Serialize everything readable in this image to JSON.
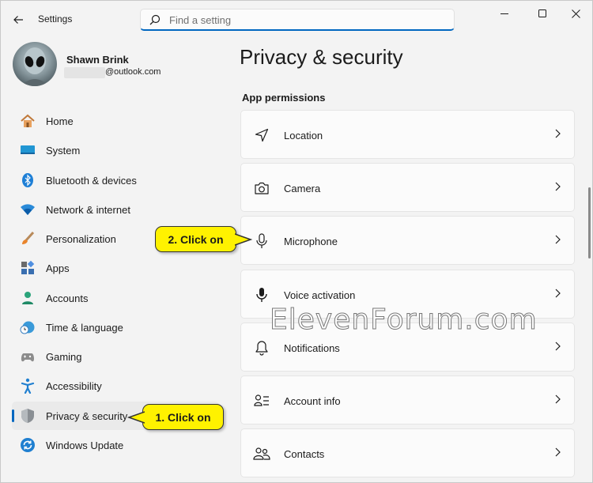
{
  "window": {
    "title": "Settings"
  },
  "search": {
    "placeholder": "Find a setting"
  },
  "profile": {
    "name": "Shawn Brink",
    "email_domain": "@outlook.com"
  },
  "sidebar": {
    "items": [
      {
        "label": "Home",
        "icon": "home-icon"
      },
      {
        "label": "System",
        "icon": "system-icon"
      },
      {
        "label": "Bluetooth & devices",
        "icon": "bluetooth-icon"
      },
      {
        "label": "Network & internet",
        "icon": "wifi-icon"
      },
      {
        "label": "Personalization",
        "icon": "brush-icon"
      },
      {
        "label": "Apps",
        "icon": "apps-icon"
      },
      {
        "label": "Accounts",
        "icon": "accounts-icon"
      },
      {
        "label": "Time & language",
        "icon": "globe-clock-icon"
      },
      {
        "label": "Gaming",
        "icon": "gamepad-icon"
      },
      {
        "label": "Accessibility",
        "icon": "accessibility-icon"
      },
      {
        "label": "Privacy & security",
        "icon": "shield-icon",
        "selected": true
      },
      {
        "label": "Windows Update",
        "icon": "update-icon"
      }
    ]
  },
  "main": {
    "title": "Privacy & security",
    "section": "App permissions",
    "rows": [
      {
        "label": "Location",
        "icon": "location-icon"
      },
      {
        "label": "Camera",
        "icon": "camera-icon"
      },
      {
        "label": "Microphone",
        "icon": "microphone-icon"
      },
      {
        "label": "Voice activation",
        "icon": "voice-activation-icon"
      },
      {
        "label": "Notifications",
        "icon": "bell-icon"
      },
      {
        "label": "Account info",
        "icon": "account-info-icon"
      },
      {
        "label": "Contacts",
        "icon": "contacts-icon"
      }
    ]
  },
  "callouts": {
    "step1": "1. Click on",
    "step2": "2. Click on"
  },
  "watermark": "ElevenForum.com",
  "colors": {
    "accent": "#0067c0",
    "callout": "#fff200",
    "background": "#f3f3f3"
  }
}
